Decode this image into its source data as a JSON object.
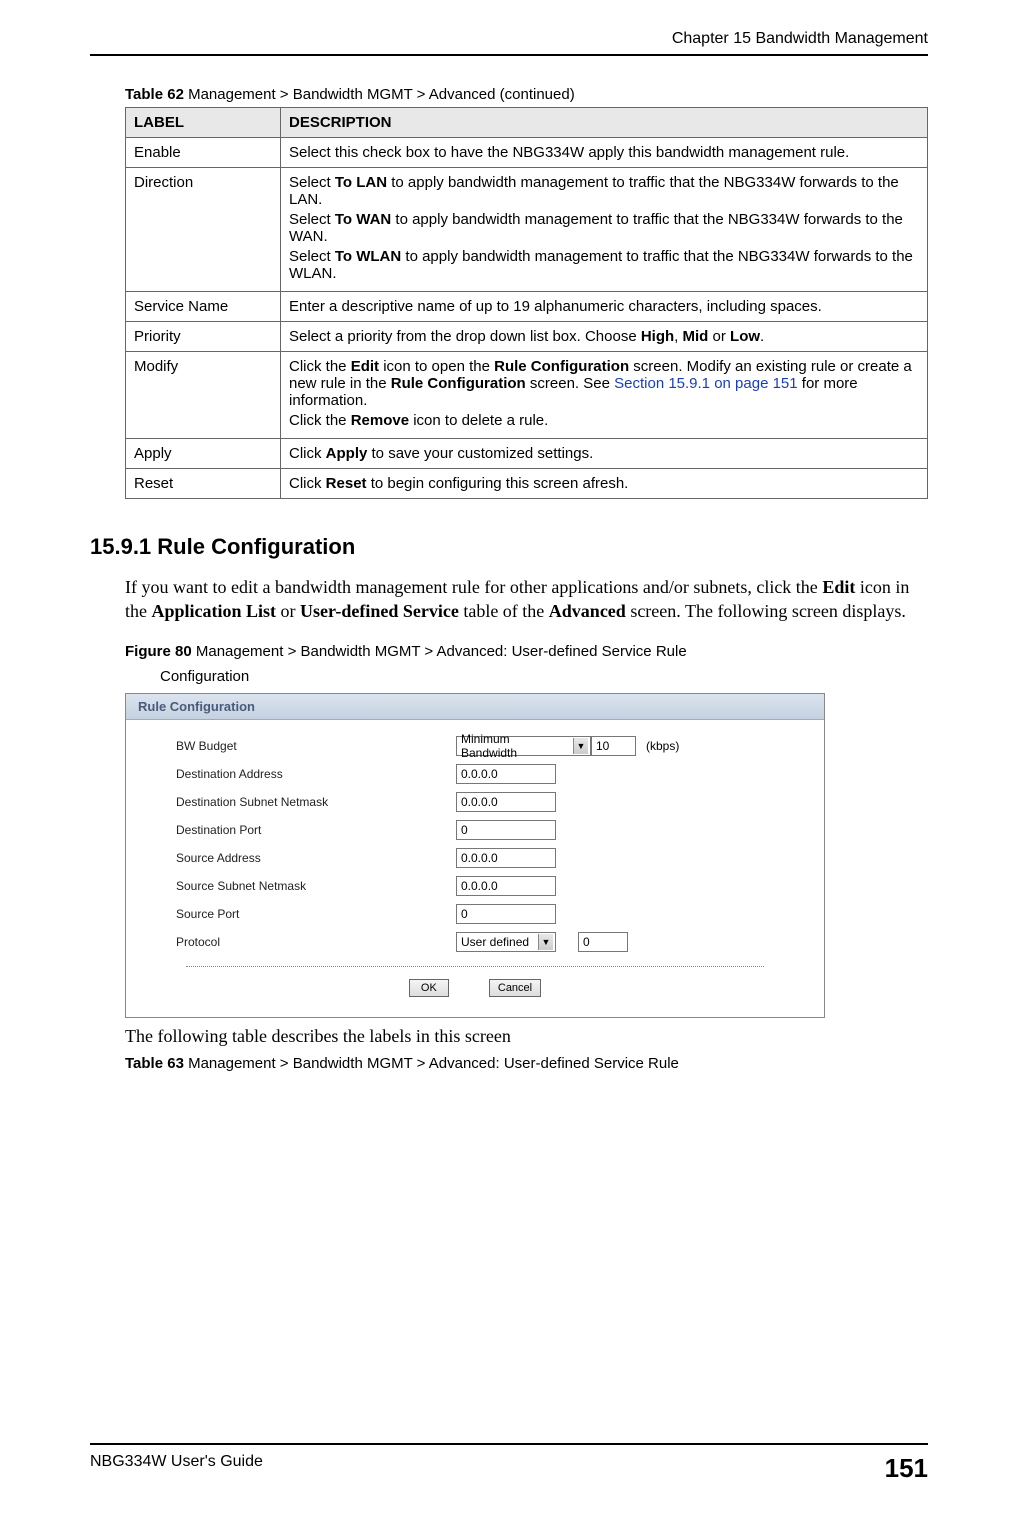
{
  "header": {
    "chapter": "Chapter 15 Bandwidth Management"
  },
  "table62": {
    "caption_bold": "Table 62",
    "caption_rest": "   Management > Bandwidth MGMT > Advanced  (continued)",
    "col1": "LABEL",
    "col2": "DESCRIPTION",
    "rows": {
      "enable": {
        "label": "Enable",
        "desc": "Select this check box to have the NBG334W apply this bandwidth management rule."
      },
      "direction": {
        "label": "Direction",
        "p1a": "Select ",
        "p1b": "To LAN",
        "p1c": " to apply bandwidth management to traffic that the NBG334W forwards to the LAN.",
        "p2a": "Select ",
        "p2b": "To WAN",
        "p2c": " to apply bandwidth management to traffic that the NBG334W forwards to the WAN.",
        "p3a": "Select ",
        "p3b": "To WLAN",
        "p3c": " to apply bandwidth management to traffic that the NBG334W forwards to the WLAN."
      },
      "service": {
        "label": "Service Name",
        "desc": "Enter a descriptive name of up to 19 alphanumeric characters, including spaces."
      },
      "priority": {
        "label": "Priority",
        "a": "Select a priority from the drop down list box. Choose ",
        "b1": "High",
        "c1": ", ",
        "b2": "Mid",
        "c2": " or ",
        "b3": "Low",
        "c3": "."
      },
      "modify": {
        "label": "Modify",
        "p1a": "Click the ",
        "p1b": "Edit",
        "p1c": " icon to open the ",
        "p1d": "Rule Configuration",
        "p1e": " screen. Modify an existing rule or create a new rule in the ",
        "p1f": "Rule Configuration",
        "p1g": " screen. See ",
        "p1link": "Section 15.9.1 on page 151",
        "p1h": " for more information.",
        "p2a": "Click the ",
        "p2b": "Remove",
        "p2c": " icon to delete a rule."
      },
      "apply": {
        "label": "Apply",
        "a": "Click ",
        "b": "Apply",
        "c": " to save your customized settings."
      },
      "reset": {
        "label": "Reset",
        "a": "Click ",
        "b": "Reset",
        "c": " to begin configuring this screen afresh."
      }
    }
  },
  "section": {
    "heading": "15.9.1  Rule Configuration",
    "body_a": "If you want to edit a bandwidth management rule for other applications and/or subnets, click the ",
    "body_b1": "Edit",
    "body_c1": " icon in the ",
    "body_b2": "Application List",
    "body_c2": " or ",
    "body_b3": "User-defined Service",
    "body_c3": " table of the ",
    "body_b4": "Advanced",
    "body_c4": " screen. The following screen displays."
  },
  "figure80": {
    "bold": "Figure 80",
    "rest": "   Management > Bandwidth MGMT > Advanced: User-defined Service Rule",
    "line2": "Configuration"
  },
  "ui": {
    "panel_title": "Rule Configuration",
    "rows": {
      "bw": {
        "label": "BW Budget",
        "select": "Minimum Bandwidth",
        "value": "10",
        "unit": "(kbps)"
      },
      "dest_addr": {
        "label": "Destination Address",
        "value": "0.0.0.0"
      },
      "dest_mask": {
        "label": "Destination Subnet Netmask",
        "value": "0.0.0.0"
      },
      "dest_port": {
        "label": "Destination Port",
        "value": "0"
      },
      "src_addr": {
        "label": "Source Address",
        "value": "0.0.0.0"
      },
      "src_mask": {
        "label": "Source Subnet Netmask",
        "value": "0.0.0.0"
      },
      "src_port": {
        "label": "Source Port",
        "value": "0"
      },
      "protocol": {
        "label": "Protocol",
        "select": "User defined",
        "value": "0"
      }
    },
    "ok": "OK",
    "cancel": "Cancel"
  },
  "after_figure": "The following table describes the labels in this screen",
  "table63": {
    "bold": "Table 63",
    "rest": "   Management > Bandwidth MGMT > Advanced: User-defined Service Rule"
  },
  "footer": {
    "title": "NBG334W User's Guide",
    "page": "151"
  }
}
